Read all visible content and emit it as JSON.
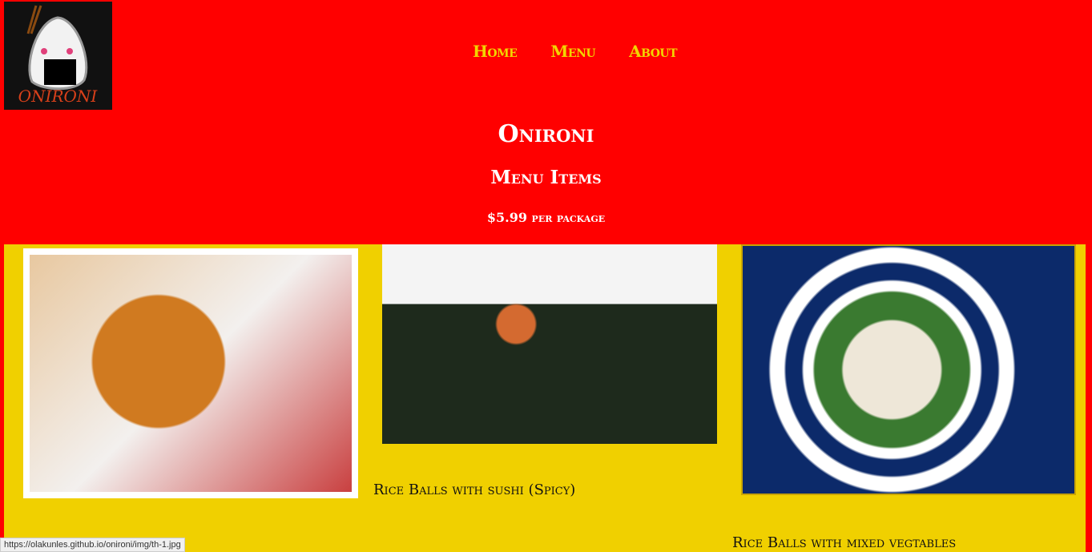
{
  "logo": {
    "text": "ONIRONI"
  },
  "nav": [
    {
      "label": "Home"
    },
    {
      "label": "Menu"
    },
    {
      "label": "About"
    }
  ],
  "header": {
    "title": "Onironi",
    "subtitle": "Menu Items",
    "price": "$5.99 per package"
  },
  "items": [
    {
      "caption": "",
      "image": "sesame rice ball"
    },
    {
      "caption": "Rice Balls with sushi (Spicy)",
      "image": "onigiri with seaweed"
    },
    {
      "caption": "Rice Balls with mixed vegtables",
      "image": "rice balls on plate"
    }
  ],
  "status_url": "https://olakunles.github.io/onironi/img/th-1.jpg"
}
